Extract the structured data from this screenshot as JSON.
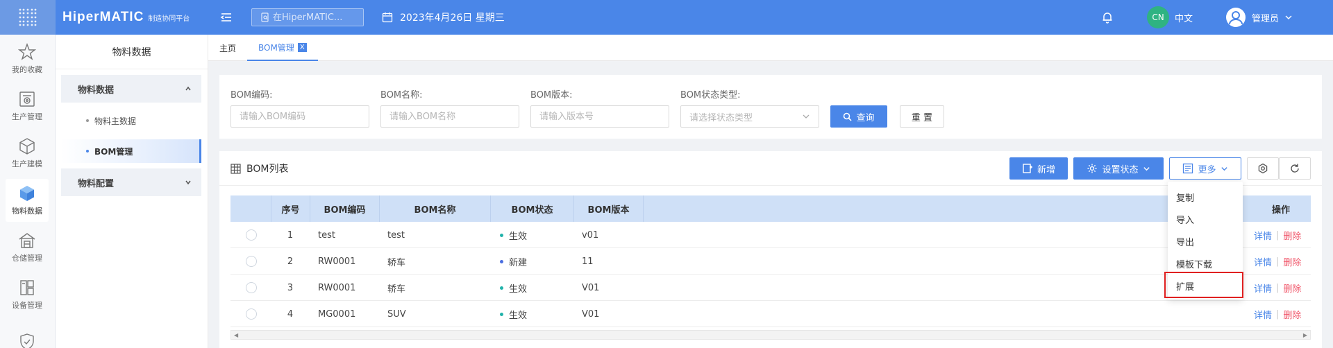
{
  "header": {
    "logo": "HiperMATIC",
    "logo_sub": "制造协同平台",
    "search_placeholder": "在HiperMATIC...",
    "date": "2023年4月26日 星期三",
    "lang_code": "CN",
    "lang_label": "中文",
    "user_name": "管理员"
  },
  "rail": {
    "items": [
      {
        "label": "我的收藏",
        "icon": "star-icon"
      },
      {
        "label": "生产管理",
        "icon": "production-icon"
      },
      {
        "label": "生产建模",
        "icon": "cube-icon"
      },
      {
        "label": "物料数据",
        "icon": "material-box-icon"
      },
      {
        "label": "仓储管理",
        "icon": "warehouse-icon"
      },
      {
        "label": "设备管理",
        "icon": "equipment-icon"
      }
    ]
  },
  "sidebar": {
    "title": "物料数据",
    "group1": "物料数据",
    "sub1": "物料主数据",
    "sub2": "BOM管理",
    "group2": "物料配置"
  },
  "tabs": {
    "home": "主页",
    "bom": "BOM管理",
    "close": "X"
  },
  "filter": {
    "code_label": "BOM编码:",
    "code_placeholder": "请输入BOM编码",
    "name_label": "BOM名称:",
    "name_placeholder": "请输入BOM名称",
    "version_label": "BOM版本:",
    "version_placeholder": "请输入版本号",
    "status_label": "BOM状态类型:",
    "status_placeholder": "请选择状态类型",
    "query_label": "查询",
    "reset_label": "重 置"
  },
  "list": {
    "title": "BOM列表",
    "add_label": "新增",
    "set_status_label": "设置状态",
    "more_label": "更多"
  },
  "table": {
    "columns": {
      "seq": "序号",
      "code": "BOM编码",
      "name": "BOM名称",
      "status": "BOM状态",
      "version": "BOM版本",
      "actions": "操作"
    },
    "rows": [
      {
        "seq": "1",
        "code": "test",
        "name": "test",
        "status": "生效",
        "version": "v01"
      },
      {
        "seq": "2",
        "code": "RW0001",
        "name": "轿车",
        "status": "新建",
        "version": "11"
      },
      {
        "seq": "3",
        "code": "RW0001",
        "name": "轿车",
        "status": "生效",
        "version": "V01"
      },
      {
        "seq": "4",
        "code": "MG0001",
        "name": "SUV",
        "status": "生效",
        "version": "V01"
      }
    ],
    "detail_label": "详情",
    "delete_label": "删除"
  },
  "dropdown": {
    "items": [
      "复制",
      "导入",
      "导出",
      "模板下载",
      "扩展"
    ]
  },
  "colors": {
    "primary": "#4a86e8",
    "status_active": "#20b2aa",
    "status_new": "#4a6ee0",
    "delete": "#f0566a",
    "highlight": "#e02020"
  }
}
